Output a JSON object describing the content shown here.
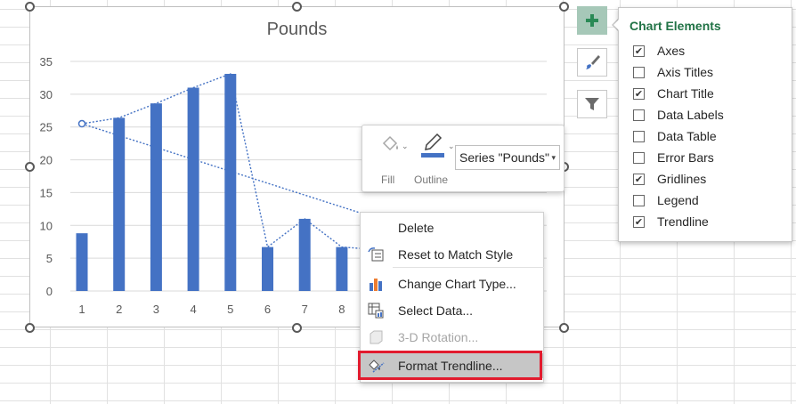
{
  "chart_data": {
    "type": "bar",
    "title": "Pounds",
    "categories": [
      "1",
      "2",
      "3",
      "4",
      "5",
      "6",
      "7",
      "8"
    ],
    "series": [
      {
        "name": "Pounds",
        "values": [
          8.8,
          26.4,
          28.6,
          31,
          33.1,
          6.7,
          11,
          6.7
        ],
        "color": "#4472c4"
      }
    ],
    "ylim": [
      0,
      35
    ],
    "yticks": [
      "0",
      "5",
      "10",
      "15",
      "20",
      "25",
      "30",
      "35"
    ],
    "gridlines": true,
    "trendline": {
      "style": "dotted",
      "color": "#4472c4"
    }
  },
  "side_buttons": [
    {
      "icon": "plus-icon",
      "active": true
    },
    {
      "icon": "brush-icon",
      "active": false
    },
    {
      "icon": "filter-icon",
      "active": false
    }
  ],
  "chart_elements": {
    "title": "Chart Elements",
    "items": [
      {
        "label": "Axes",
        "checked": true
      },
      {
        "label": "Axis Titles",
        "checked": false
      },
      {
        "label": "Chart Title",
        "checked": true
      },
      {
        "label": "Data Labels",
        "checked": false
      },
      {
        "label": "Data Table",
        "checked": false
      },
      {
        "label": "Error Bars",
        "checked": false
      },
      {
        "label": "Gridlines",
        "checked": true
      },
      {
        "label": "Legend",
        "checked": false
      },
      {
        "label": "Trendline",
        "checked": true
      }
    ]
  },
  "mini_toolbar": {
    "fill_label": "Fill",
    "outline_label": "Outline",
    "series_value": "Series \"Pounds\"",
    "outline_color": "#4472c4"
  },
  "context_menu": {
    "items": [
      {
        "label": "Delete",
        "icon": "none",
        "disabled": false,
        "highlight": false
      },
      {
        "label": "Reset to Match Style",
        "icon": "reset-style-icon",
        "disabled": false,
        "highlight": false
      },
      {
        "label": "Change Chart Type...",
        "icon": "chart-type-icon",
        "disabled": false,
        "highlight": false
      },
      {
        "label": "Select Data...",
        "icon": "select-data-icon",
        "disabled": false,
        "highlight": false
      },
      {
        "label": "3-D Rotation...",
        "icon": "rotation-3d-icon",
        "disabled": true,
        "highlight": false
      },
      {
        "label": "Format Trendline...",
        "icon": "format-trendline-icon",
        "disabled": false,
        "highlight": true
      }
    ]
  }
}
